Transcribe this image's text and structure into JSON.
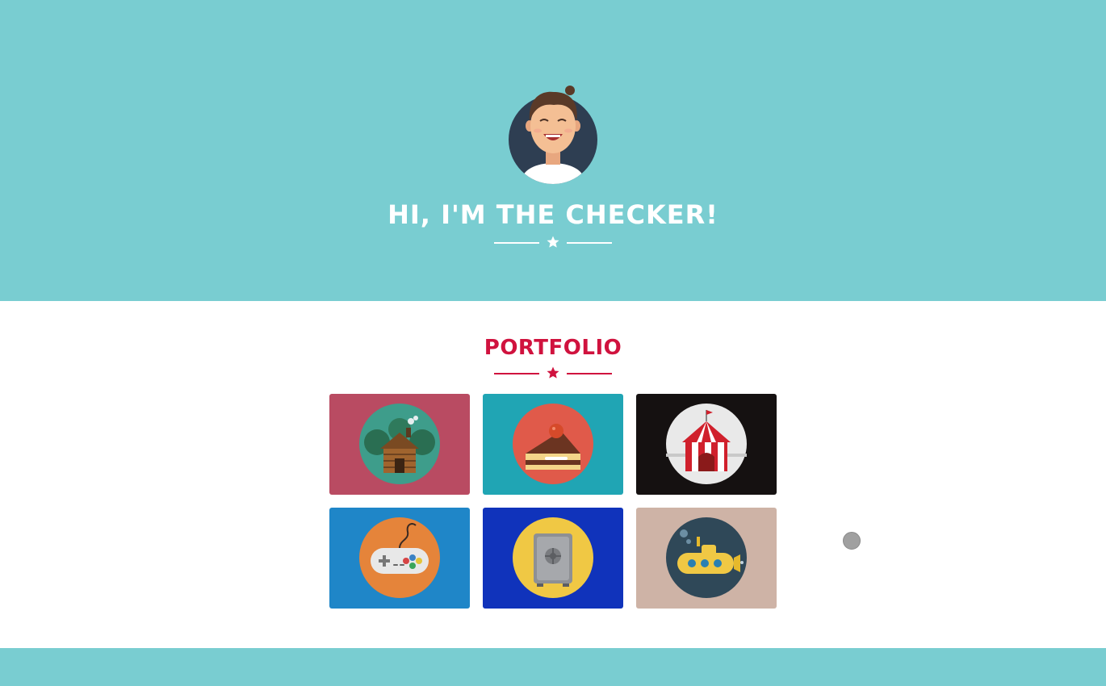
{
  "colors": {
    "header_bg": "#79cdd1",
    "accent": "#d0123e",
    "white": "#ffffff",
    "footer_bg": "#79cdd1"
  },
  "header": {
    "avatar_icon": "avatar-smiling-man-icon",
    "title": "HI, I'M THE CHECKER!",
    "divider_icon": "star-icon"
  },
  "portfolio": {
    "title": "PORTFOLIO",
    "divider_icon": "star-icon",
    "items": [
      {
        "icon": "log-cabin-icon",
        "bg": "#b94b62",
        "circle": "#3e9d8b"
      },
      {
        "icon": "cake-slice-icon",
        "bg": "#20a5b4",
        "circle": "#e05a4a"
      },
      {
        "icon": "circus-tent-icon",
        "bg": "#151111",
        "circle": "#e9e9e9"
      },
      {
        "icon": "game-controller-icon",
        "bg": "#1f86c8",
        "circle": "#e5843a"
      },
      {
        "icon": "safe-icon",
        "bg": "#1033bb",
        "circle": "#f0c844"
      },
      {
        "icon": "submarine-icon",
        "bg": "#ceb3a6",
        "circle": "#2f4858"
      }
    ]
  },
  "floating_dot_icon": "cursor-dot-icon"
}
